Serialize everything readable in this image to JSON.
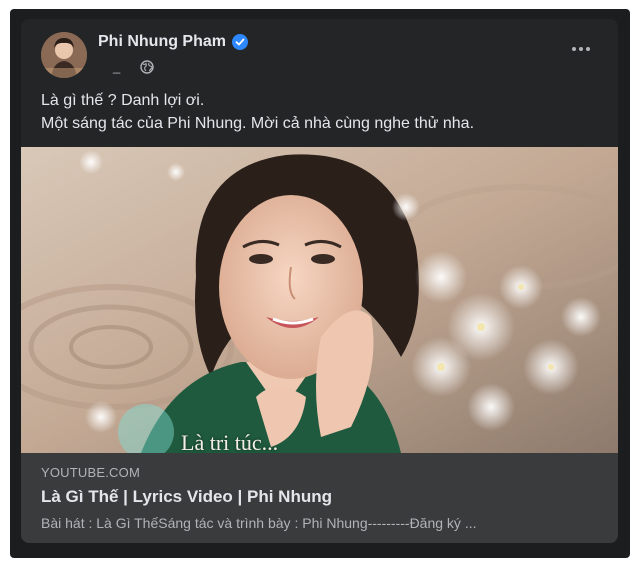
{
  "post": {
    "author_name": "Phi Nhung Pham",
    "timestamp": "_",
    "audience_icon": "globe-icon",
    "verified_icon": "verified-badge-icon",
    "more_icon": "more-options-icon",
    "text_line_1": "Là gì thế ? Danh lợi ơi.",
    "text_line_2": "Một sáng tác của Phi Nhung. Mời cả nhà cùng nghe thử nha."
  },
  "media": {
    "caption": "Là tri túc..."
  },
  "link_preview": {
    "domain": "YOUTUBE.COM",
    "title": "Là Gì Thế | Lyrics Video | Phi Nhung",
    "description": "Bài hát : Là Gì ThếSáng tác và trình bày : Phi Nhung---------Đăng ký ..."
  },
  "colors": {
    "card_background": "#242526",
    "link_box_background": "#3a3b3c",
    "primary_text": "#e4e6eb",
    "secondary_text": "#b0b3b8",
    "verified_blue": "#2d88ff"
  }
}
